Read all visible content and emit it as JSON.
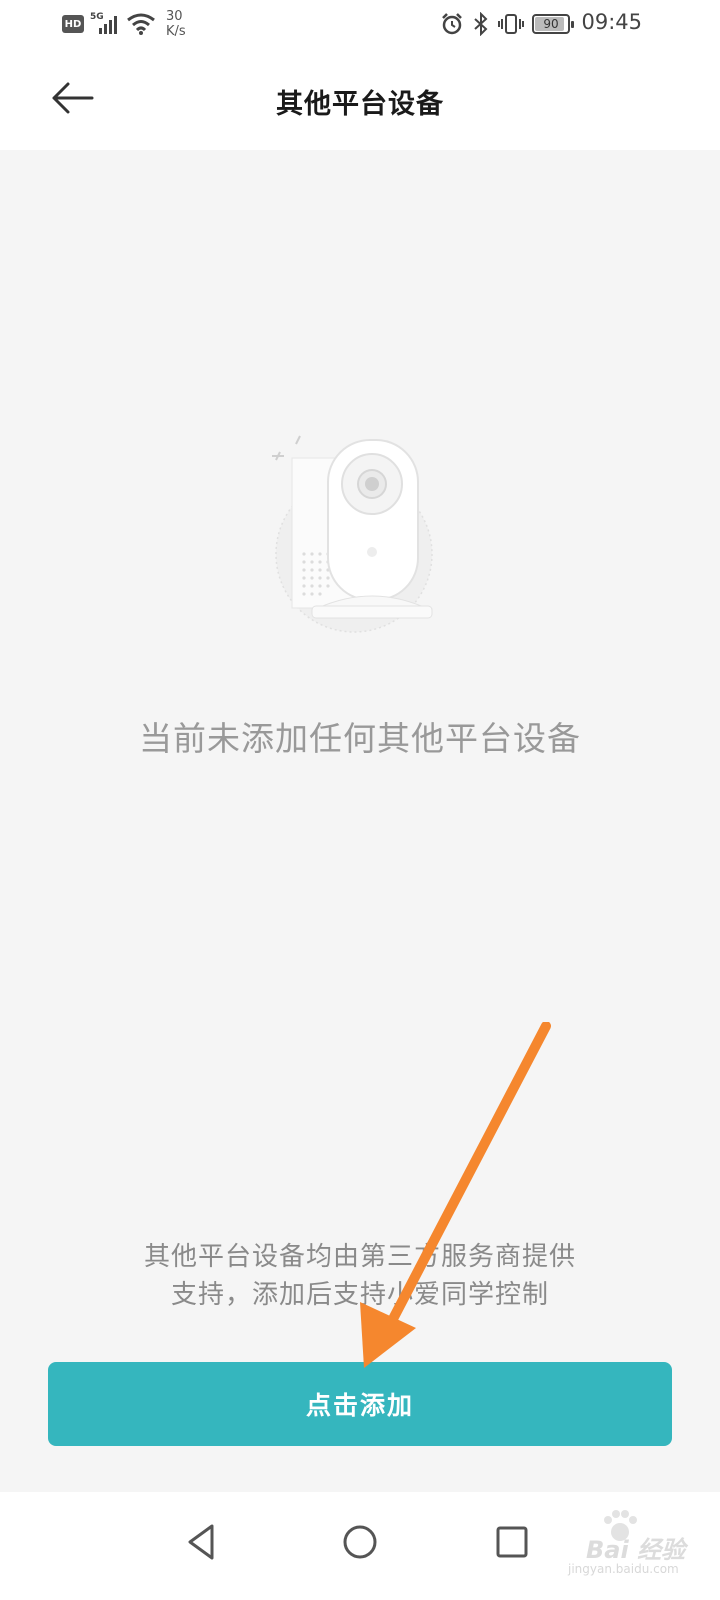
{
  "status_bar": {
    "hd": "HD",
    "network": "5G",
    "speed_value": "30",
    "speed_unit": "K/s",
    "battery_level": "90",
    "time": "09:45",
    "icons": [
      "alarm-icon",
      "bluetooth-icon",
      "vibrate-icon",
      "battery-icon",
      "wifi-icon",
      "signal-icon"
    ]
  },
  "header": {
    "title": "其他平台设备",
    "back_icon": "arrow-left-icon"
  },
  "main": {
    "illustration": "camera-icon",
    "empty_message": "当前未添加任何其他平台设备",
    "footnote_line1": "其他平台设备均由第三方服务商提供",
    "footnote_line2": "支持，添加后支持小爱同学控制",
    "add_button_label": "点击添加",
    "annotation": "arrow-pointer-icon",
    "colors": {
      "accent": "#35b6be",
      "annotation": "#f5872e",
      "background": "#f5f5f5"
    }
  },
  "nav_bar": {
    "items": [
      "back-triangle-icon",
      "home-circle-icon",
      "recents-square-icon"
    ]
  },
  "watermark": {
    "logo_text": "Bai 经验",
    "url": "jingyan.baidu.com"
  }
}
